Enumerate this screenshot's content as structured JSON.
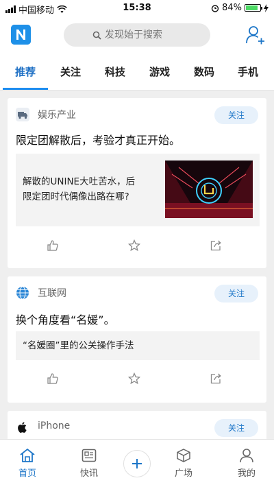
{
  "status_bar": {
    "carrier": "中国移动",
    "time": "15:38",
    "battery": "84%",
    "battery_level": 0.84
  },
  "header": {
    "logo_letter": "N",
    "search_placeholder": "发现始于搜索"
  },
  "tabs": [
    {
      "label": "推荐",
      "active": true
    },
    {
      "label": "关注"
    },
    {
      "label": "科技"
    },
    {
      "label": "游戏"
    },
    {
      "label": "数码"
    },
    {
      "label": "手机"
    }
  ],
  "feed": [
    {
      "source": "娱乐产业",
      "follow_label": "关注",
      "title": "限定团解散后，考验才真正开始。",
      "link_text_1": "解散的UNINE大吐苦水，后",
      "link_text_2": "限定团时代偶像出路在哪?"
    },
    {
      "source": "互联网",
      "follow_label": "关注",
      "title": "换个角度看“名媛”。",
      "link_text": "“名媛圈”里的公关操作手法"
    },
    {
      "source": "iPhone",
      "follow_label": "关注"
    }
  ],
  "bottom_nav": [
    {
      "label": "首页",
      "active": true
    },
    {
      "label": "快讯"
    },
    {
      "label": "广场"
    },
    {
      "label": "我的"
    }
  ],
  "colors": {
    "accent": "#1d76c8",
    "logo": "#1e90e8"
  }
}
